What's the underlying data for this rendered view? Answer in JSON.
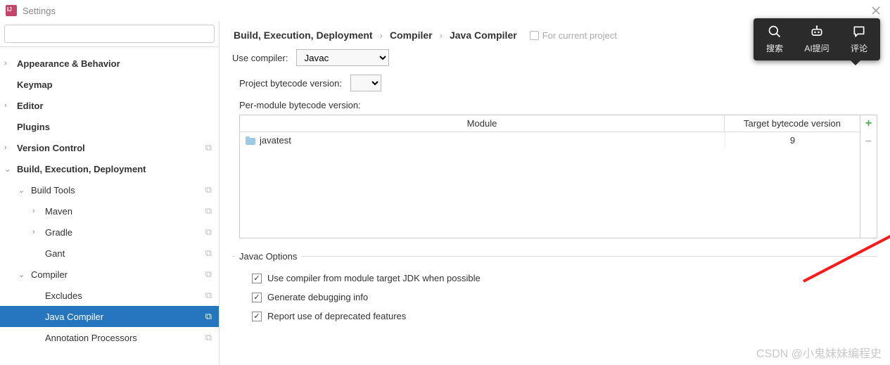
{
  "window": {
    "title": "Settings"
  },
  "search": {
    "placeholder": ""
  },
  "tree": [
    {
      "label": "Appearance & Behavior",
      "indent": 0,
      "chevron": ">",
      "bold": true,
      "badge": false
    },
    {
      "label": "Keymap",
      "indent": 0,
      "chevron": "",
      "bold": true,
      "badge": false
    },
    {
      "label": "Editor",
      "indent": 0,
      "chevron": ">",
      "bold": true,
      "badge": false
    },
    {
      "label": "Plugins",
      "indent": 0,
      "chevron": "",
      "bold": true,
      "badge": false
    },
    {
      "label": "Version Control",
      "indent": 0,
      "chevron": ">",
      "bold": true,
      "badge": true
    },
    {
      "label": "Build, Execution, Deployment",
      "indent": 0,
      "chevron": "v",
      "bold": true,
      "badge": false
    },
    {
      "label": "Build Tools",
      "indent": 1,
      "chevron": "v",
      "bold": false,
      "badge": true
    },
    {
      "label": "Maven",
      "indent": 2,
      "chevron": ">",
      "bold": false,
      "badge": true
    },
    {
      "label": "Gradle",
      "indent": 2,
      "chevron": ">",
      "bold": false,
      "badge": true
    },
    {
      "label": "Gant",
      "indent": 2,
      "chevron": "",
      "bold": false,
      "badge": true
    },
    {
      "label": "Compiler",
      "indent": 1,
      "chevron": "v",
      "bold": false,
      "badge": true
    },
    {
      "label": "Excludes",
      "indent": 2,
      "chevron": "",
      "bold": false,
      "badge": true
    },
    {
      "label": "Java Compiler",
      "indent": 2,
      "chevron": "",
      "bold": false,
      "badge": true,
      "selected": true
    },
    {
      "label": "Annotation Processors",
      "indent": 2,
      "chevron": "",
      "bold": false,
      "badge": true
    }
  ],
  "breadcrumb": {
    "parts": [
      "Build, Execution, Deployment",
      "Compiler",
      "Java Compiler"
    ],
    "scope": "For current project"
  },
  "form": {
    "use_compiler_label": "Use compiler:",
    "use_compiler_value": "Javac",
    "project_bytecode_label": "Project bytecode version:",
    "project_bytecode_value": "",
    "per_module_label": "Per-module bytecode version:"
  },
  "table": {
    "head_module": "Module",
    "head_version": "Target bytecode version",
    "rows": [
      {
        "module": "javatest",
        "version": "9"
      }
    ]
  },
  "javac_options": {
    "legend": "Javac Options",
    "opts": [
      {
        "label": "Use compiler from module target JDK when possible",
        "checked": true
      },
      {
        "label": "Generate debugging info",
        "checked": true
      },
      {
        "label": "Report use of deprecated features",
        "checked": true
      }
    ]
  },
  "overlay": {
    "search": "搜索",
    "ai": "AI提问",
    "comment": "评论"
  },
  "watermark": "CSDN @小鬼妹妹编程史"
}
